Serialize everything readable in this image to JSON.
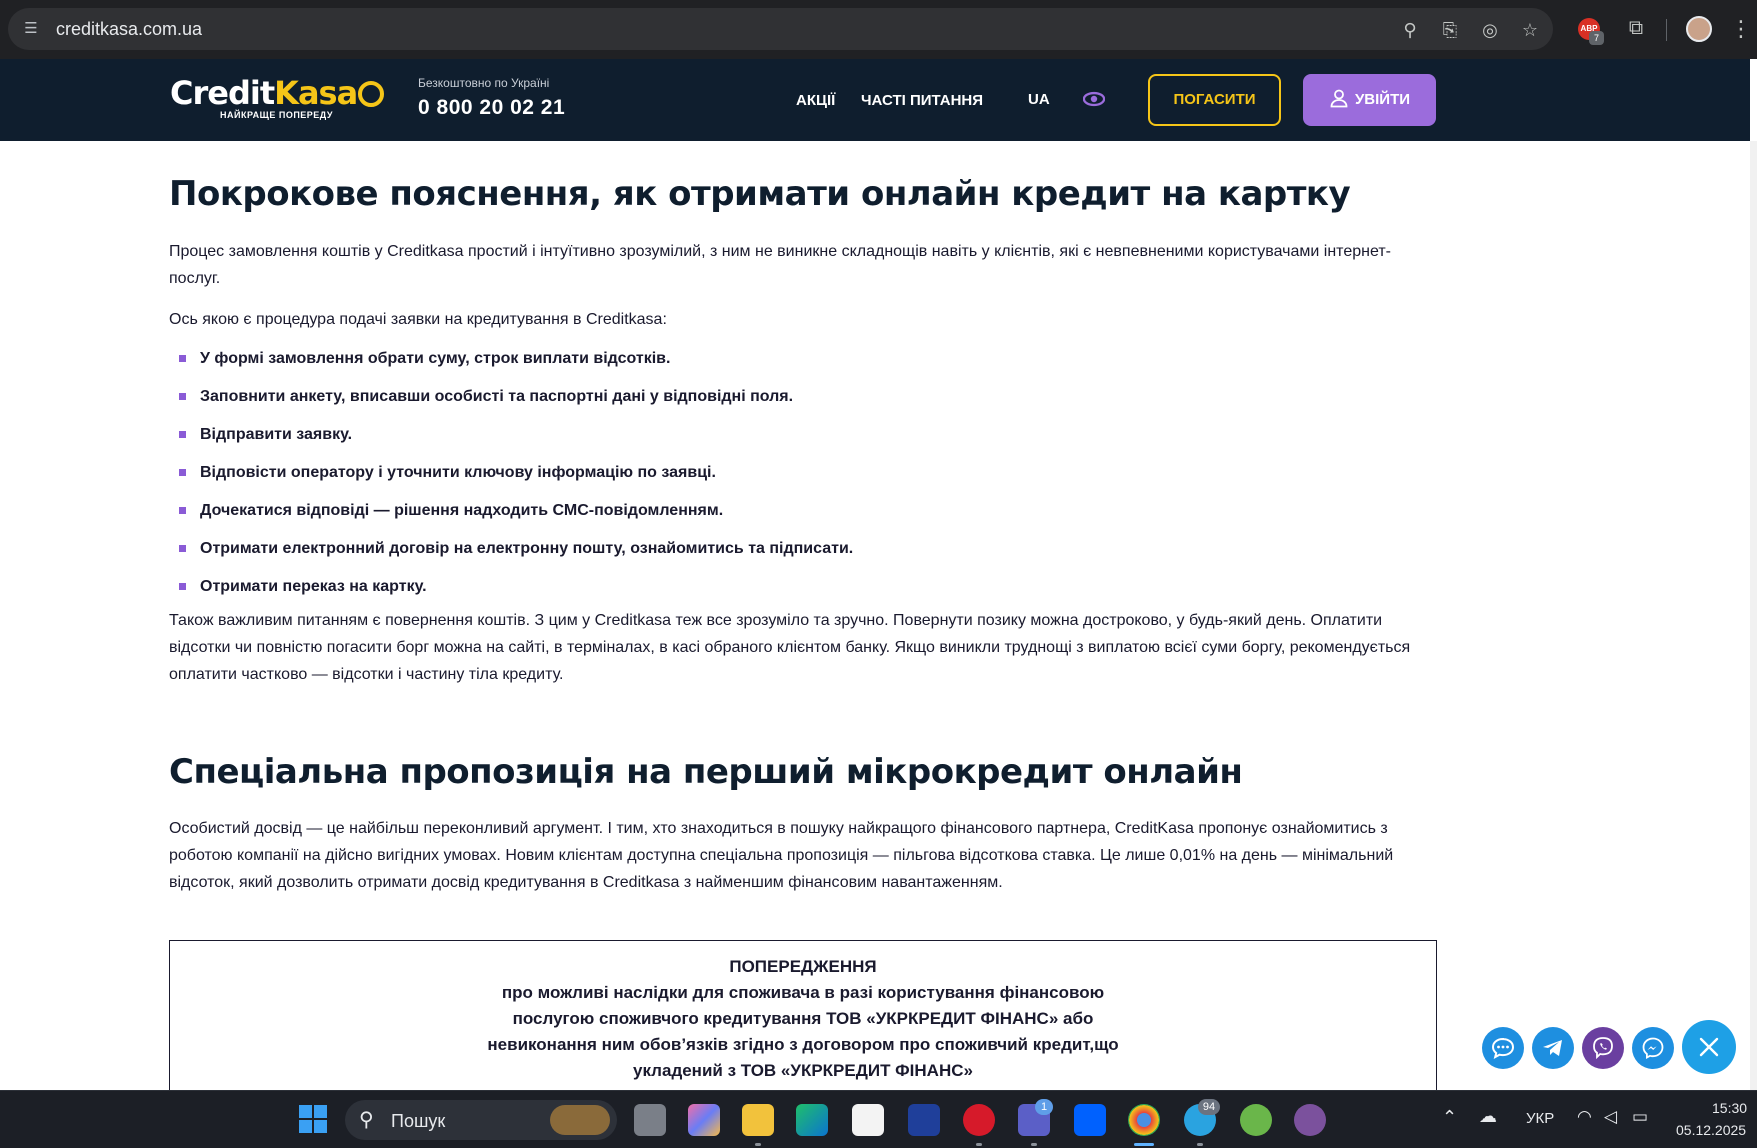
{
  "browser": {
    "url": "creditkasa.com.ua",
    "extension_badge_count": "7",
    "extension_label": "ABP"
  },
  "header": {
    "logo_credit": "Credit",
    "logo_kasa": "Kasa",
    "logo_tagline": "НАЙКРАЩЕ ПОПЕРЕДУ",
    "phone_note": "Безкоштовно по Україні",
    "phone": "0 800 20 02 21",
    "nav": {
      "promotions": "АКЦІЇ",
      "faq": "ЧАСТІ ПИТАННЯ",
      "language": "UA"
    },
    "pay_button": "ПОГАСИТИ",
    "login_button": "УВІЙТИ"
  },
  "main": {
    "section1": {
      "title": "Покрокове пояснення, як отримати онлайн кредит на картку",
      "intro": "Процес замовлення коштів у Creditkasa простий і інтуїтивно зрозумілий, з ним не виникне складнощів навіть у клієнтів, які є невпевненими користувачами інтернет-послуг.",
      "lead": "Ось якою є процедура подачі заявки на кредитування в Creditkasa:",
      "steps": [
        "У формі замовлення обрати суму, строк виплати відсотків.",
        "Заповнити анкету, вписавши особисті та паспортні дані у відповідні поля.",
        "Відправити заявку.",
        "Відповісти оператору і уточнити ключову інформацію по заявці.",
        "Дочекатися відповіді — рішення надходить СМС-повідомленням.",
        "Отримати електронний договір на електронну пошту, ознайомитись та підписати.",
        "Отримати переказ на картку."
      ],
      "outro": "Також важливим питанням є повернення коштів. З цим у Creditkasa теж все зрозуміло та зручно. Повернути позику можна достроково, у будь-який день. Оплатити відсотки чи повністю погасити борг можна на сайті, в терміналах, в касі обраного клієнтом банку. Якщо виникли труднощі з виплатою всієї суми боргу, рекомендується оплатити частково — відсотки і частину тіла кредиту."
    },
    "section2": {
      "title": "Спеціальна пропозиція на перший мікрокредит онлайн",
      "body": "Особистий досвід — це найбільш переконливий аргумент. І тим, хто знаходиться в пошуку найкращого фінансового партнера, CreditKasa пропонує ознайомитись з роботою компанії на дійсно вигідних умовах. Новим клієнтам доступна спеціальна пропозиція — пільгова відсоткова ставка. Це лише 0,01% на день — мінімальний відсоток, який дозволить отримати досвід кредитування в Creditkasa з найменшим фінансовим навантаженням."
    },
    "warning": {
      "lines": [
        "ПОПЕРЕДЖЕННЯ",
        "про можливі наслідки для споживача в разі користування фінансовою",
        "послугою споживчого кредитування ТОВ «УКРКРЕДИТ ФІНАНС» або",
        "невиконання ним обов’язків згідно з договором про споживчий кредит,що",
        "укладений з ТОВ «УКРКРЕДИТ ФІНАНС»"
      ]
    }
  },
  "floating_contacts": {
    "colors": {
      "chat": "#1e8fe0",
      "telegram": "#1e8fe0",
      "viber": "#6a3fa0",
      "messenger": "#1e8fe0",
      "close": "#1ea0e6"
    }
  },
  "taskbar": {
    "search_placeholder": "Пошук",
    "teams_badge": "1",
    "telegram_badge": "94",
    "language": "УКР",
    "time": "15:30",
    "date": "05.12.2025"
  },
  "colors": {
    "header_bg": "#0f1e2e",
    "accent_yellow": "#f5c518",
    "accent_purple": "#9b6cdc",
    "bullet": "#8a5bd6"
  }
}
